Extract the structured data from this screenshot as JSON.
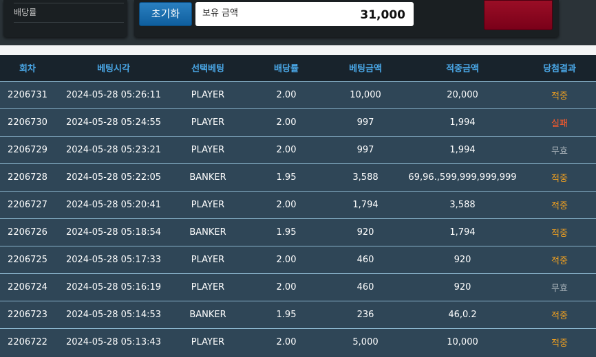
{
  "top": {
    "odds_label": "배당률",
    "reset_label": "초기화",
    "amount_label": "보유 금액",
    "amount_value": "31,000"
  },
  "table": {
    "headers": [
      "회차",
      "베팅시각",
      "선택베팅",
      "배당률",
      "베팅금액",
      "적중금액",
      "당첨결과"
    ],
    "rows": [
      [
        "2206731",
        "2024-05-28 05:26:11",
        "PLAYER",
        "2.00",
        "10,000",
        "20,000",
        "적중"
      ],
      [
        "2206730",
        "2024-05-28 05:24:55",
        "PLAYER",
        "2.00",
        "997",
        "1,994",
        "실패"
      ],
      [
        "2206729",
        "2024-05-28 05:23:21",
        "PLAYER",
        "2.00",
        "997",
        "1,994",
        "무효"
      ],
      [
        "2206728",
        "2024-05-28 05:22:05",
        "BANKER",
        "1.95",
        "3,588",
        "69,96.,599,999,999,999",
        "적중"
      ],
      [
        "2206727",
        "2024-05-28 05:20:41",
        "PLAYER",
        "2.00",
        "1,794",
        "3,588",
        "적중"
      ],
      [
        "2206726",
        "2024-05-28 05:18:54",
        "BANKER",
        "1.95",
        "920",
        "1,794",
        "적중"
      ],
      [
        "2206725",
        "2024-05-28 05:17:33",
        "PLAYER",
        "2.00",
        "460",
        "920",
        "적중"
      ],
      [
        "2206724",
        "2024-05-28 05:16:19",
        "PLAYER",
        "2.00",
        "460",
        "920",
        "무효"
      ],
      [
        "2206723",
        "2024-05-28 05:14:53",
        "BANKER",
        "1.95",
        "236",
        "46,0.2",
        "적중"
      ],
      [
        "2206722",
        "2024-05-28 05:13:43",
        "PLAYER",
        "2.00",
        "5,000",
        "10,000",
        "적중"
      ]
    ]
  },
  "colors": {
    "hit": "#f0a020",
    "fail": "#ff5a2a",
    "void": "#a9b3ba",
    "header_text": "#4aa8e8"
  }
}
